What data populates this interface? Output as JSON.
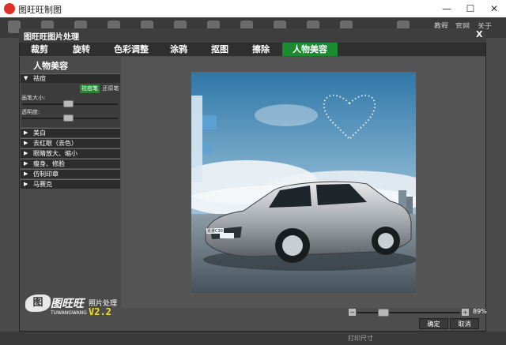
{
  "app": {
    "title": "图旺旺制图",
    "window_controls": [
      "—",
      "☐",
      "✕"
    ],
    "top_links": [
      "教程",
      "官网",
      "关于"
    ],
    "bottom_items": [
      "打印尺寸"
    ]
  },
  "dialog": {
    "title": "图旺旺图片处理",
    "close": "X",
    "tabs": [
      {
        "label": "裁剪",
        "active": false
      },
      {
        "label": "旋转",
        "active": false
      },
      {
        "label": "色彩调整",
        "active": false
      },
      {
        "label": "涂鸦",
        "active": false
      },
      {
        "label": "抠图",
        "active": false
      },
      {
        "label": "擦除",
        "active": false
      },
      {
        "label": "人物美容",
        "active": true
      }
    ]
  },
  "panel": {
    "header": "人物美容",
    "open_section": {
      "label": "祛痘",
      "mode_active": "祛痘笔",
      "mode_other": "还原笔",
      "brush_size_label": "画笔大小:",
      "brush_size_value": 0.48,
      "opacity_label": "透明度:",
      "opacity_value": 0.48
    },
    "sections": [
      "美白",
      "去红眼（去色）",
      "眼睛放大、缩小",
      "瘦身、修脸",
      "仿制印章",
      "马赛克"
    ]
  },
  "canvas": {
    "photo_badge": "嘉景C30"
  },
  "zoom": {
    "minus": "−",
    "plus": "+",
    "value": "89%",
    "fraction": 0.22
  },
  "buttons": {
    "ok": "确定",
    "cancel": "取消"
  },
  "brand": {
    "mark": "图",
    "name": "图旺旺",
    "english": "TUWANGWANG",
    "product": "照片处理",
    "version": "V2.2"
  },
  "colors": {
    "accent_green": "#1c8a2f",
    "version_yellow": "#f0e020"
  }
}
